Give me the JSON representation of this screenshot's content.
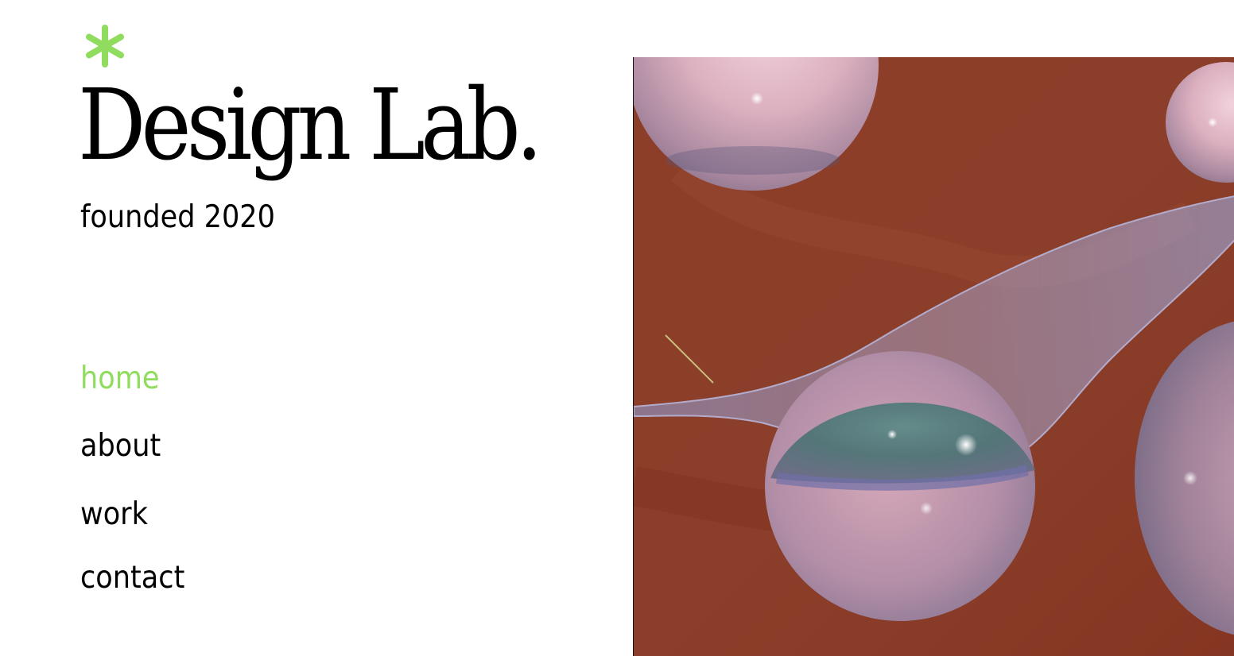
{
  "brand": {
    "title": "Design Lab.",
    "subtitle": "founded 2020",
    "logo_icon": "asterisk-icon",
    "accent_color": "#8fdc5e"
  },
  "nav": {
    "items": [
      {
        "label": "home",
        "active": true
      },
      {
        "label": "about",
        "active": false
      },
      {
        "label": "work",
        "active": false
      },
      {
        "label": "contact",
        "active": false
      }
    ]
  },
  "hero": {
    "image": "abstract-3d-glass-spheres-render",
    "background_color": "#8a3b24"
  }
}
